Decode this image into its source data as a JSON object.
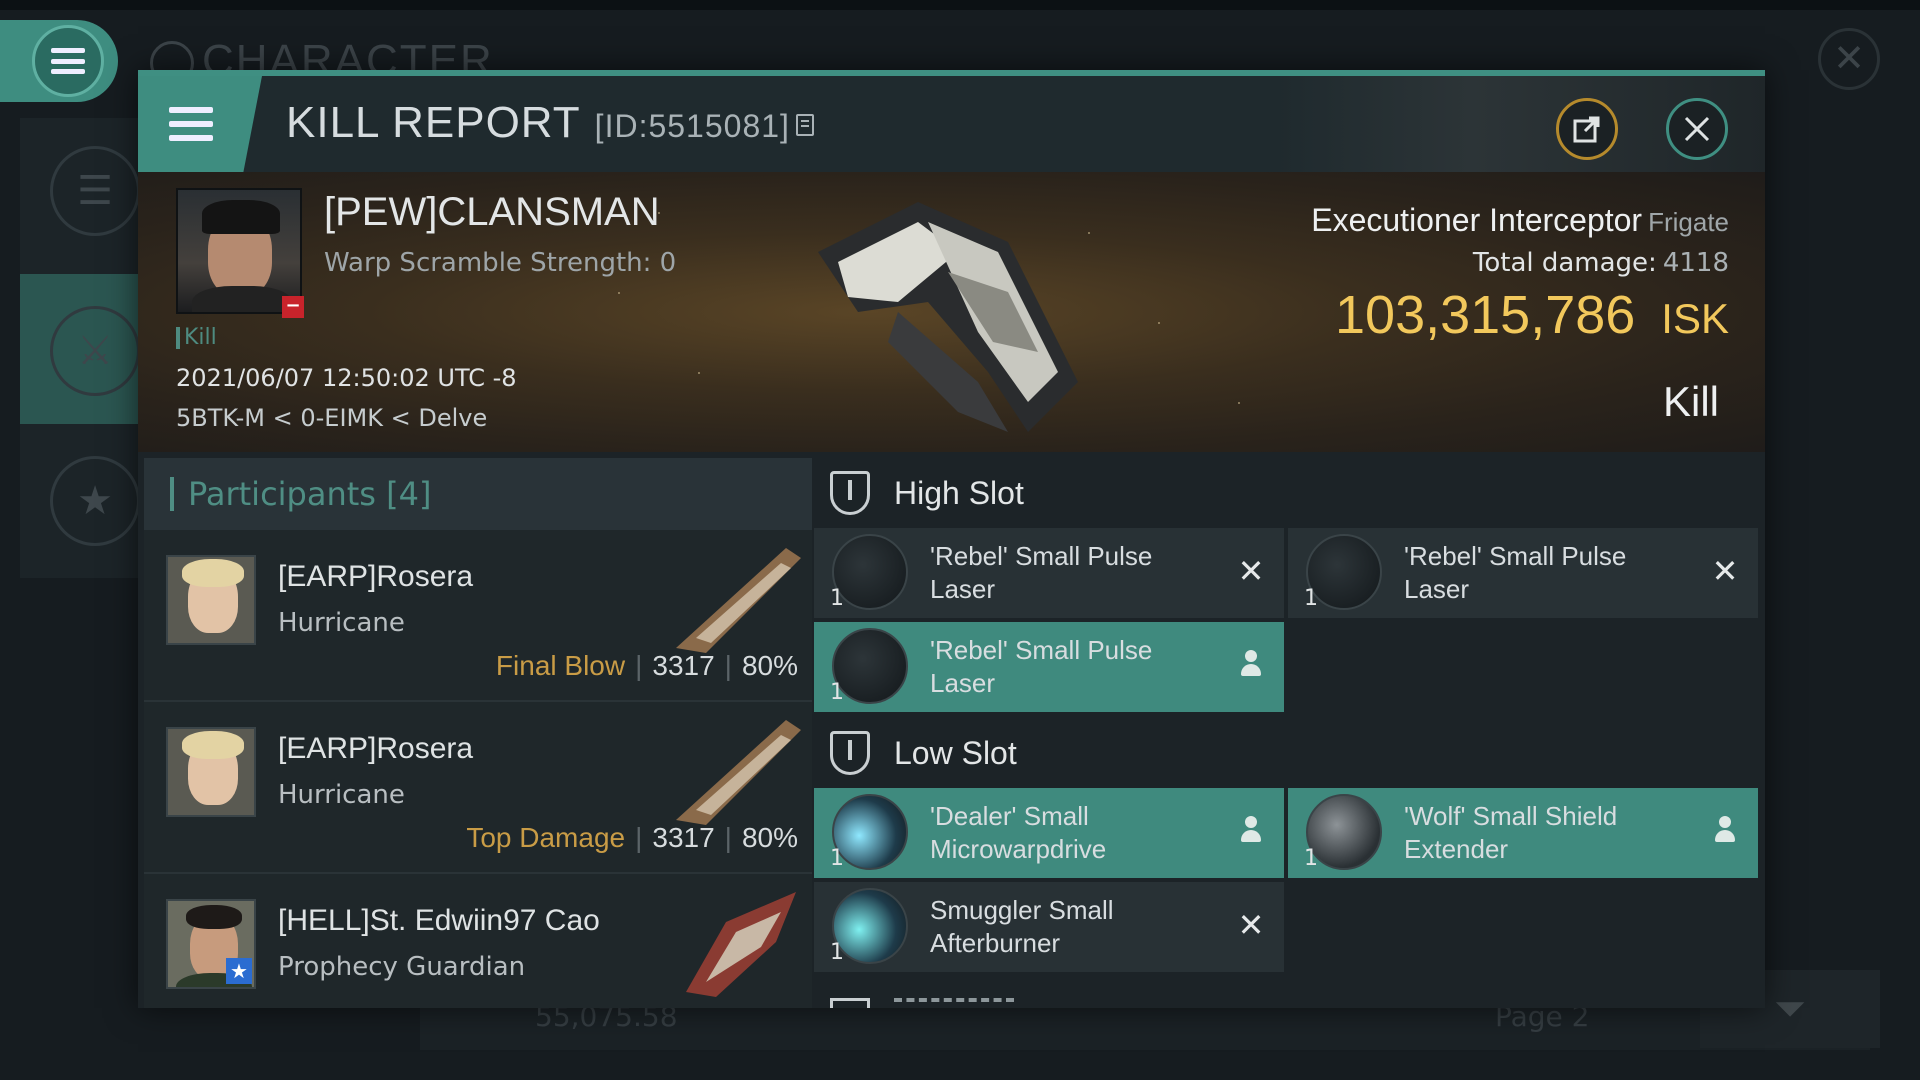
{
  "background": {
    "title": "CHARACTER",
    "page_label": "Page 2",
    "value_text": "55,075.58"
  },
  "header": {
    "title": "KILL REPORT",
    "id_text": "[ID:5515081]"
  },
  "victim": {
    "name": "[PEW]CLANSMAN",
    "warp_scramble": "Warp Scramble Strength: 0",
    "tag": "Kill",
    "datetime": "2021/06/07 12:50:02 UTC -8",
    "location": "5BTK-M < 0-EIMK < Delve"
  },
  "ship": {
    "name": "Executioner Interceptor",
    "class": "Frigate",
    "damage_label": "Total damage:",
    "damage_value": "4118",
    "isk_value": "103,315,786",
    "isk_unit": "ISK",
    "result": "Kill"
  },
  "participants": {
    "header": "Participants [4]",
    "rows": [
      {
        "name": "[EARP]Rosera",
        "ship": "Hurricane",
        "role": "Final Blow",
        "damage": "3317",
        "percent": "80%"
      },
      {
        "name": "[EARP]Rosera",
        "ship": "Hurricane",
        "role": "Top Damage",
        "damage": "3317",
        "percent": "80%"
      },
      {
        "name": "[HELL]St. Edwiin97 Cao",
        "ship": "Prophecy Guardian",
        "role": "",
        "damage": "",
        "percent": ""
      }
    ]
  },
  "fitting": {
    "high_slot": {
      "title": "High Slot",
      "modules": [
        {
          "qty": "1",
          "name": "'Rebel' Small Pulse Laser",
          "status": "destroyed"
        },
        {
          "qty": "1",
          "name": "'Rebel' Small Pulse Laser",
          "status": "destroyed"
        },
        {
          "qty": "1",
          "name": "'Rebel' Small Pulse Laser",
          "status": "dropped"
        }
      ]
    },
    "low_slot": {
      "title": "Low Slot",
      "modules": [
        {
          "qty": "1",
          "name": "'Dealer' Small Microwarpdrive",
          "status": "dropped"
        },
        {
          "qty": "1",
          "name": "'Wolf' Small Shield Extender",
          "status": "dropped"
        },
        {
          "qty": "1",
          "name": "Smuggler Small Afterburner",
          "status": "destroyed"
        }
      ]
    }
  },
  "colors": {
    "accent": "#3f8f82",
    "isk": "#f2c85c",
    "role": "#c99c46",
    "victim_badge": "#c8232b"
  }
}
